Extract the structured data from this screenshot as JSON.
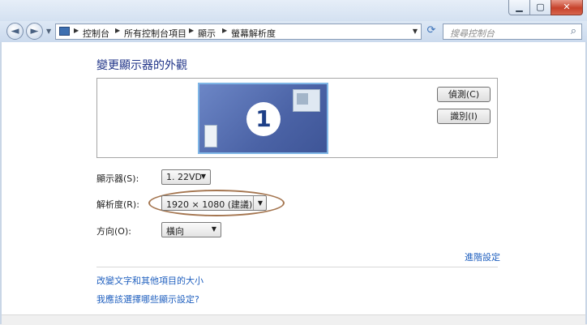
{
  "window": {
    "title_bar_text": "",
    "minimize_icon": "minimize-icon",
    "maximize_icon": "maximize-icon",
    "close_icon": "close-icon"
  },
  "nav": {
    "breadcrumbs": [
      "控制台",
      "所有控制台項目",
      "顯示",
      "螢幕解析度"
    ],
    "search_placeholder": "搜尋控制台"
  },
  "main": {
    "title": "變更顯示器的外觀",
    "monitor_number": "1",
    "detect_button": "偵測(C)",
    "identify_button": "識別(I)",
    "display_label": "顯示器(S):",
    "display_value": "1. 22VD",
    "resolution_label": "解析度(R):",
    "resolution_value": "1920 × 1080 (建議)",
    "orientation_label": "方向(O):",
    "orientation_value": "橫向",
    "advanced_link": "進階設定",
    "text_size_link": "改變文字和其他項目的大小",
    "which_settings_link": "我應該選擇哪些顯示設定?"
  },
  "colors": {
    "title": "#1e3287",
    "link": "#1f5fbf",
    "highlight": "#a4754f",
    "monitor": "#4b63a6"
  }
}
